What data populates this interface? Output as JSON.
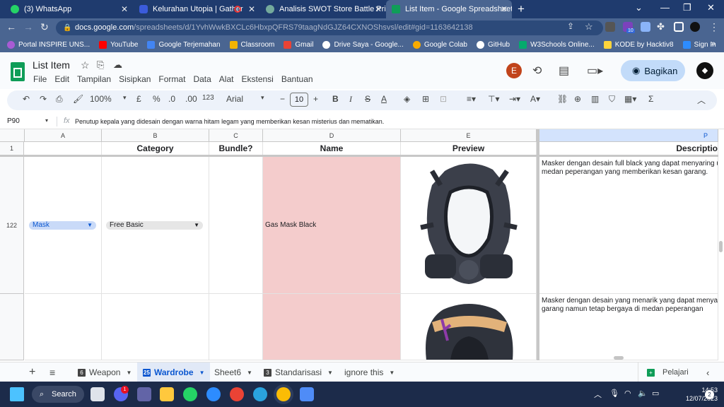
{
  "browser": {
    "tabs": [
      {
        "title": "(3) WhatsApp",
        "color": "#25d366"
      },
      {
        "title": "Kelurahan Utopia | Gather",
        "color": "#3b5bdb"
      },
      {
        "title": "Analisis SWOT Store Battle Prime",
        "color": "#74aa9c"
      },
      {
        "title": "List Item - Google Spreadsheet",
        "color": "#0f9d58",
        "active": true
      }
    ],
    "new_tab": "+",
    "url_main": "docs.google.com",
    "url_rest": "/spreadsheets/d/1YvhWwkBXCLc6HbxpQFRS79taagNdGJZ64CXNOShsvsl/edit#gid=1163642138",
    "ext_badge": "10",
    "bookmarks": [
      {
        "label": "Portal INSPIRE UNS...",
        "color": "#a85bd4"
      },
      {
        "label": "YouTube",
        "color": "#ff0000"
      },
      {
        "label": "Google Terjemahan",
        "color": "#4285f4"
      },
      {
        "label": "Classroom",
        "color": "#f4b400"
      },
      {
        "label": "Gmail",
        "color": "#ea4335"
      },
      {
        "label": "Drive Saya - Google...",
        "color": "#34a853"
      },
      {
        "label": "Google Colab",
        "color": "#f9ab00"
      },
      {
        "label": "GitHub",
        "color": "#ffffff"
      },
      {
        "label": "W3Schools Online...",
        "color": "#04aa6d"
      },
      {
        "label": "KODE by Hacktiv8",
        "color": "#ffd43b"
      },
      {
        "label": "Sign In",
        "color": "#2d8cff"
      }
    ]
  },
  "app": {
    "title": "List Item",
    "menus": [
      "File",
      "Edit",
      "Tampilan",
      "Sisipkan",
      "Format",
      "Data",
      "Alat",
      "Ekstensi",
      "Bantuan"
    ],
    "avatar_letter": "E",
    "share_label": "Bagikan"
  },
  "toolbar": {
    "zoom": "100%",
    "currency": "£",
    "percent": "%",
    "dec_less": ".0",
    "dec_more": ".00",
    "num_format": "123",
    "font": "Arial",
    "font_size": "10"
  },
  "formula_bar": {
    "cell_ref": "P90",
    "fx": "fx",
    "content": "Penutup kepala yang didesain dengan warna hitam legam yang memberikan kesan misterius dan mematikan."
  },
  "grid": {
    "columns": [
      "A",
      "B",
      "C",
      "D",
      "E",
      "P"
    ],
    "header_row_num": "1",
    "headers": {
      "category": "Category",
      "bundle": "Bundle?",
      "name": "Name",
      "preview": "Preview",
      "desc": "Descriptio"
    },
    "rows": [
      {
        "num": "122",
        "type": "Mask",
        "category": "Free Basic",
        "name": "Gas Mask Black",
        "desc_line1": "Masker dengan desain full black yang dapat menyaring u",
        "desc_line2": "medan peperangan yang memberikan kesan garang."
      },
      {
        "num": "",
        "desc_line1": "Masker dengan desain yang menarik yang dapat menya",
        "desc_line2": "garang namun tetap bergaya di medan peperangan"
      }
    ],
    "colors": {
      "name_fill": "#f4cccc",
      "type_chip": "#c9daf8",
      "category_chip": "#e6e6e6"
    }
  },
  "sheet_tabs": {
    "tabs": [
      {
        "label": "Weapon",
        "badge": "6"
      },
      {
        "label": "Wardrobe",
        "badge": "25",
        "active": true
      },
      {
        "label": "Sheet6"
      },
      {
        "label": "Standarisasi",
        "badge": "3"
      },
      {
        "label": "ignore this"
      }
    ],
    "explore": "Pelajari"
  },
  "taskbar": {
    "search": "Search",
    "time": "14:53",
    "date": "12/07/2023",
    "notif": "2",
    "discord_badge": "1"
  }
}
